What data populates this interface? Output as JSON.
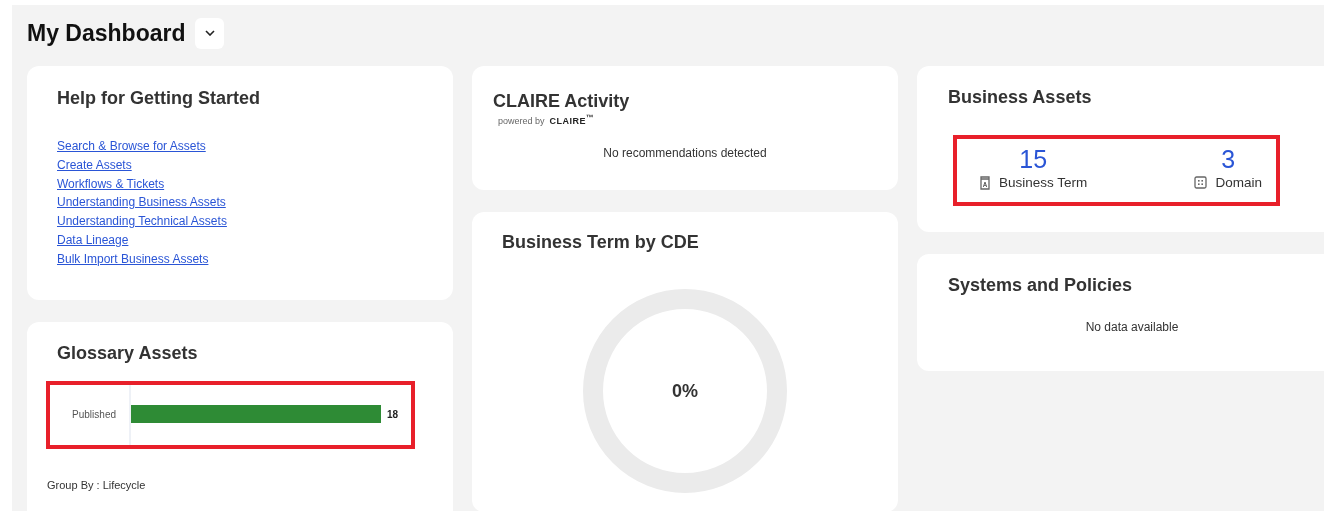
{
  "page": {
    "title": "My Dashboard"
  },
  "help": {
    "title": "Help for Getting Started",
    "links": [
      "Search & Browse for Assets",
      "Create Assets",
      "Workflows & Tickets",
      "Understanding Business Assets",
      "Understanding Technical Assets",
      "Data Lineage",
      "Bulk Import Business Assets"
    ]
  },
  "glossary": {
    "title": "Glossary Assets",
    "chart_data": {
      "type": "bar",
      "orientation": "horizontal",
      "categories": [
        "Published"
      ],
      "values": [
        18
      ],
      "data_labels": true
    },
    "group_by": "Group By : Lifecycle"
  },
  "claire": {
    "title": "CLAIRE Activity",
    "powered_by": "powered by",
    "logo": "CLAIRE$^{™}$",
    "message": "No recommendations detected"
  },
  "cde": {
    "title": "Business Term by CDE",
    "level": 0,
    "percent": "0%"
  },
  "business_assets": {
    "title": "Business Assets",
    "stats": [
      {
        "kind": "term",
        "count": "15",
        "label": "Business Term"
      },
      {
        "kind": "domain",
        "count": "3",
        "label": "Domain"
      }
    ]
  },
  "systems": {
    "title": "Systems and Policies",
    "message": "No data available"
  }
}
